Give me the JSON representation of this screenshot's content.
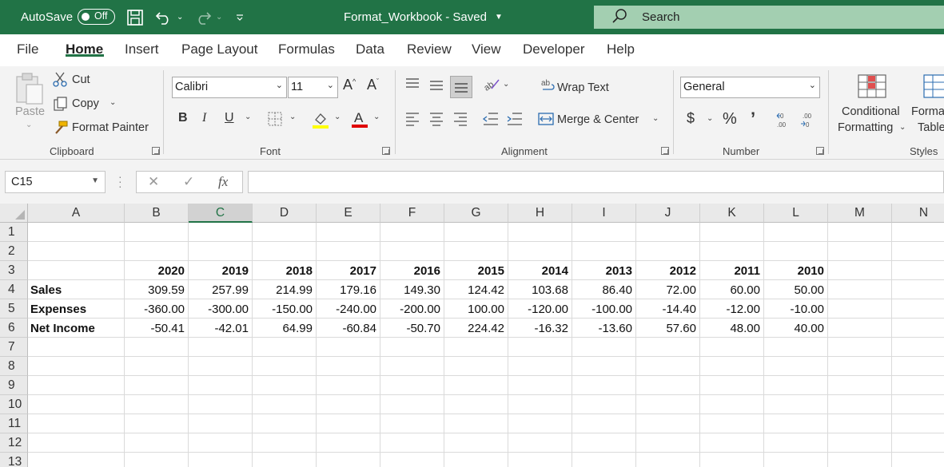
{
  "titlebar": {
    "autosave_label": "AutoSave",
    "autosave_state": "Off",
    "title": "Format_Workbook  -  Saved",
    "search_placeholder": "Search"
  },
  "menu": {
    "tabs": [
      "File",
      "Home",
      "Insert",
      "Page Layout",
      "Formulas",
      "Data",
      "Review",
      "View",
      "Developer",
      "Help"
    ],
    "active": "Home"
  },
  "ribbon": {
    "clipboard": {
      "paste": "Paste",
      "cut": "Cut",
      "copy": "Copy",
      "format_painter": "Format Painter",
      "label": "Clipboard"
    },
    "font": {
      "name": "Calibri",
      "size": "11",
      "bold": "B",
      "italic": "I",
      "underline": "U",
      "label": "Font",
      "fill_color": "#ffff00",
      "font_color": "#e00000"
    },
    "alignment": {
      "wrap_text": "Wrap Text",
      "merge_center": "Merge & Center",
      "label": "Alignment"
    },
    "number": {
      "format": "General",
      "currency": "$",
      "percent": "%",
      "comma": "’",
      "label": "Number"
    },
    "styles": {
      "conditional_1": "Conditional",
      "conditional_2": "Formatting",
      "format_1": "Forma",
      "format_2": "Table",
      "label": "Styles"
    }
  },
  "formula_bar": {
    "name_box": "C15",
    "fx": "fx",
    "content": ""
  },
  "sheet": {
    "columns": [
      "A",
      "B",
      "C",
      "D",
      "E",
      "F",
      "G",
      "H",
      "I",
      "J",
      "K",
      "L",
      "M",
      "N"
    ],
    "selected_column": "C",
    "rows": [
      "1",
      "2",
      "3",
      "4",
      "5",
      "6",
      "7",
      "8",
      "9",
      "10",
      "11",
      "12",
      "13"
    ],
    "header_row": [
      "",
      "2020",
      "2019",
      "2018",
      "2017",
      "2016",
      "2015",
      "2014",
      "2013",
      "2012",
      "2011",
      "2010"
    ],
    "data": [
      {
        "label": "Sales",
        "values": [
          "309.59",
          "257.99",
          "214.99",
          "179.16",
          "149.30",
          "124.42",
          "103.68",
          "86.40",
          "72.00",
          "60.00",
          "50.00"
        ]
      },
      {
        "label": "Expenses",
        "values": [
          "-360.00",
          "-300.00",
          "-150.00",
          "-240.00",
          "-200.00",
          "100.00",
          "-120.00",
          "-100.00",
          "-14.40",
          "-12.00",
          "-10.00"
        ]
      },
      {
        "label": "Net Income",
        "values": [
          "-50.41",
          "-42.01",
          "64.99",
          "-60.84",
          "-50.70",
          "224.42",
          "-16.32",
          "-13.60",
          "57.60",
          "48.00",
          "40.00"
        ]
      }
    ]
  },
  "colors": {
    "brand": "#217346",
    "search_bg": "#a3cfb1"
  }
}
